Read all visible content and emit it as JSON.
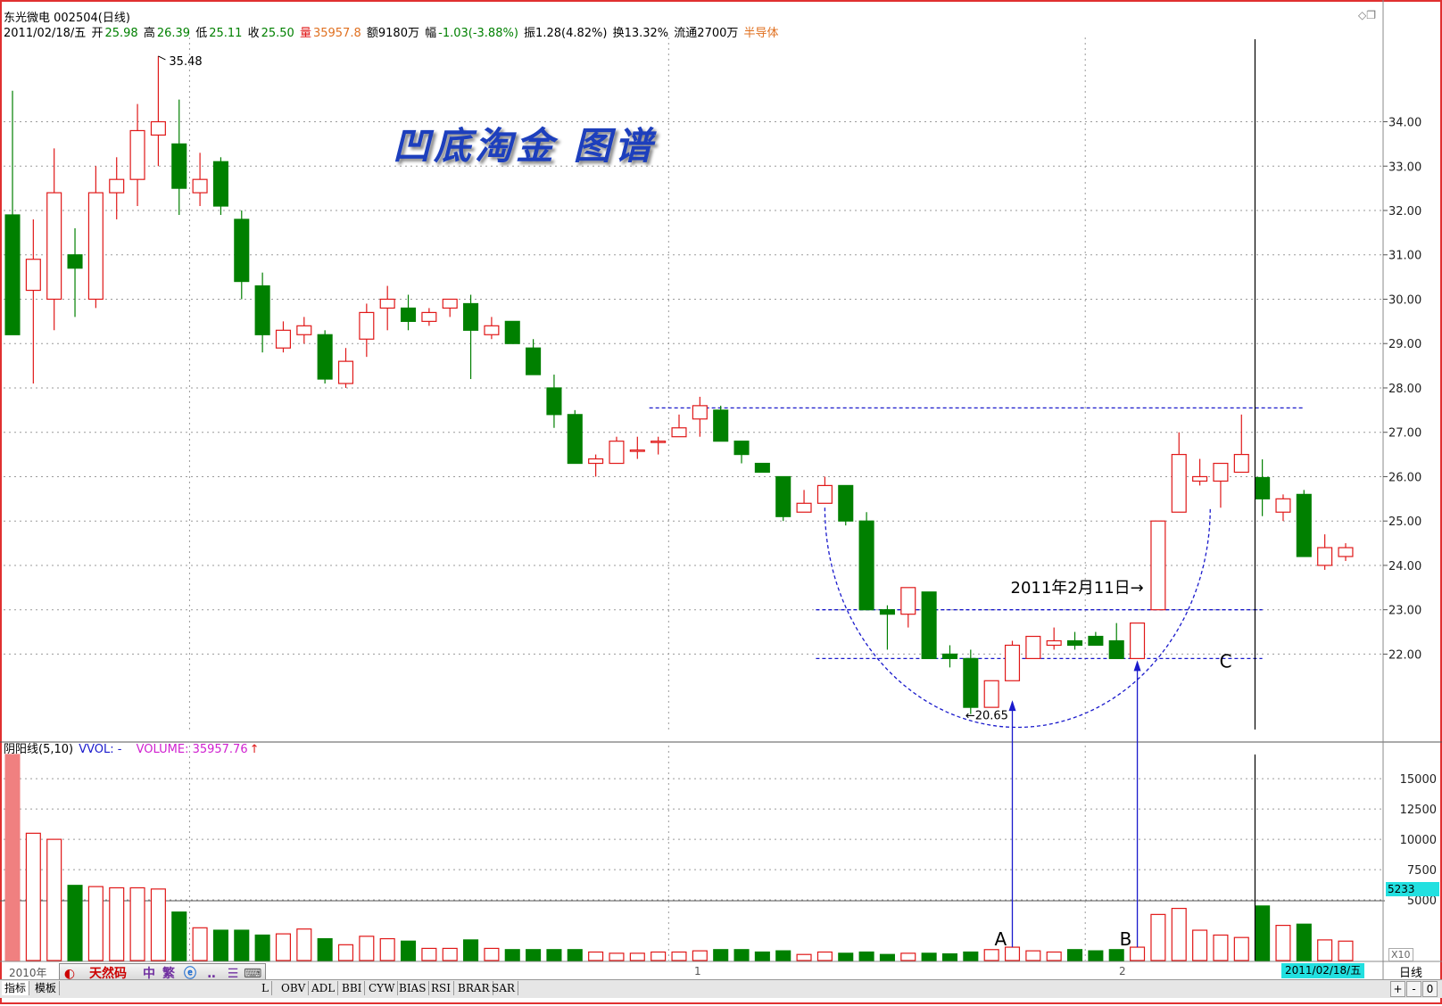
{
  "header": {
    "stock_name": "东光微电 002504(日线)",
    "date": "2011/02/18/五",
    "open_label": "开",
    "open": "25.98",
    "high_label": "高",
    "high": "26.39",
    "low_label": "低",
    "low": "25.11",
    "close_label": "收",
    "close": "25.50",
    "vol_label": "量",
    "vol": "35957.8",
    "amount": "额9180万",
    "range_label": "幅",
    "range": "-1.03(-3.88%)",
    "swing": "振1.28(4.82%)",
    "turnover": "换13.32%",
    "float_shares": "流通2700万",
    "sector": "半导体"
  },
  "watermark": "凹底淘金 图谱",
  "annotations": {
    "max_label": "35.48",
    "min_label": "←20.65",
    "date_note": "2011年2月11日→",
    "point_a": "A",
    "point_b": "B",
    "point_c": "C"
  },
  "volume_header": {
    "title": "阴阳线(5,10)",
    "vol_label": "VVOL: -",
    "volume_label": "VOLUME: 35957.76"
  },
  "volume_badge": "5233",
  "xaxis": {
    "year_label": "2010年",
    "month1": "1",
    "month2": "2",
    "cursor_date": "2011/02/18/五",
    "period": "日线"
  },
  "price_scale_label": "X10",
  "toolbar": {
    "ime_label": "天然码",
    "zh_label": "中",
    "trad_label": "繁"
  },
  "tabs": [
    "指标",
    "模板",
    "L",
    "OBV",
    "ADL",
    "BBI",
    "CYW",
    "BIAS",
    "RSI",
    "BRAR",
    "SAR"
  ],
  "bottom_buttons": [
    "+",
    "-",
    "0"
  ],
  "colors": {
    "up": "#e01818",
    "down": "#008000",
    "grid": "#9a9a9a",
    "annotation_line": "#1a1acc",
    "watermark": "#1d3fbd",
    "badge_bg": "#22e0e0"
  },
  "chart_data": {
    "type": "candlestick",
    "price_axis_ticks": [
      22.0,
      23.0,
      24.0,
      25.0,
      26.0,
      27.0,
      28.0,
      29.0,
      30.0,
      31.0,
      32.0,
      33.0,
      34.0
    ],
    "price_axis_tick_labels": [
      "22.00",
      "23.00",
      "24.00",
      "25.00",
      "26.00",
      "27.00",
      "28.00",
      "29.00",
      "30.00",
      "31.00",
      "32.00",
      "33.00",
      "34.00"
    ],
    "ylim": [
      20.3,
      35.9
    ],
    "volume_axis_ticks": [
      5000,
      7500,
      10000,
      12500,
      15000
    ],
    "volume_axis_tick_labels": [
      "5000",
      "7500",
      "10000",
      "12500",
      "15000"
    ],
    "volume_ylim": [
      0,
      17000
    ],
    "candles": [
      {
        "o": 31.9,
        "h": 34.7,
        "l": 29.2,
        "c": 29.2,
        "v": 17000
      },
      {
        "o": 30.2,
        "h": 31.8,
        "l": 28.1,
        "c": 30.9,
        "v": 10500
      },
      {
        "o": 30.0,
        "h": 33.4,
        "l": 29.3,
        "c": 32.4,
        "v": 10000
      },
      {
        "o": 31.0,
        "h": 31.6,
        "l": 29.6,
        "c": 30.7,
        "v": 6200
      },
      {
        "o": 30.0,
        "h": 33.0,
        "l": 29.8,
        "c": 32.4,
        "v": 6100
      },
      {
        "o": 32.4,
        "h": 33.2,
        "l": 31.8,
        "c": 32.7,
        "v": 6000
      },
      {
        "o": 32.7,
        "h": 34.4,
        "l": 32.1,
        "c": 33.8,
        "v": 6000
      },
      {
        "o": 33.7,
        "h": 35.48,
        "l": 33.0,
        "c": 34.0,
        "v": 5900
      },
      {
        "o": 33.5,
        "h": 34.5,
        "l": 31.9,
        "c": 32.5,
        "v": 4000
      },
      {
        "o": 32.4,
        "h": 33.3,
        "l": 32.1,
        "c": 32.7,
        "v": 2700
      },
      {
        "o": 33.1,
        "h": 33.2,
        "l": 31.9,
        "c": 32.1,
        "v": 2500
      },
      {
        "o": 31.8,
        "h": 32.0,
        "l": 30.0,
        "c": 30.4,
        "v": 2500
      },
      {
        "o": 30.3,
        "h": 30.6,
        "l": 28.8,
        "c": 29.2,
        "v": 2100
      },
      {
        "o": 28.9,
        "h": 29.5,
        "l": 28.8,
        "c": 29.3,
        "v": 2200
      },
      {
        "o": 29.2,
        "h": 29.6,
        "l": 29.0,
        "c": 29.4,
        "v": 2600
      },
      {
        "o": 29.2,
        "h": 29.3,
        "l": 28.1,
        "c": 28.2,
        "v": 1800
      },
      {
        "o": 28.1,
        "h": 28.9,
        "l": 28.0,
        "c": 28.6,
        "v": 1300
      },
      {
        "o": 29.1,
        "h": 29.9,
        "l": 28.7,
        "c": 29.7,
        "v": 2000
      },
      {
        "o": 29.8,
        "h": 30.3,
        "l": 29.3,
        "c": 30.0,
        "v": 1800
      },
      {
        "o": 29.8,
        "h": 30.1,
        "l": 29.3,
        "c": 29.5,
        "v": 1600
      },
      {
        "o": 29.5,
        "h": 29.8,
        "l": 29.4,
        "c": 29.7,
        "v": 1000
      },
      {
        "o": 29.8,
        "h": 30.0,
        "l": 29.6,
        "c": 30.0,
        "v": 1000
      },
      {
        "o": 29.9,
        "h": 30.1,
        "l": 28.2,
        "c": 29.3,
        "v": 1700
      },
      {
        "o": 29.2,
        "h": 29.6,
        "l": 29.1,
        "c": 29.4,
        "v": 1000
      },
      {
        "o": 29.5,
        "h": 29.5,
        "l": 29.0,
        "c": 29.0,
        "v": 900
      },
      {
        "o": 28.9,
        "h": 29.1,
        "l": 28.3,
        "c": 28.3,
        "v": 900
      },
      {
        "o": 28.0,
        "h": 28.3,
        "l": 27.1,
        "c": 27.4,
        "v": 900
      },
      {
        "o": 27.4,
        "h": 27.5,
        "l": 26.4,
        "c": 26.3,
        "v": 900
      },
      {
        "o": 26.3,
        "h": 26.5,
        "l": 26.0,
        "c": 26.4,
        "v": 700
      },
      {
        "o": 26.3,
        "h": 26.9,
        "l": 26.3,
        "c": 26.8,
        "v": 600
      },
      {
        "o": 26.6,
        "h": 26.9,
        "l": 26.4,
        "c": 26.6,
        "v": 600
      },
      {
        "o": 26.8,
        "h": 26.9,
        "l": 26.5,
        "c": 26.8,
        "v": 700
      },
      {
        "o": 26.9,
        "h": 27.4,
        "l": 26.9,
        "c": 27.1,
        "v": 700
      },
      {
        "o": 27.3,
        "h": 27.8,
        "l": 26.9,
        "c": 27.6,
        "v": 800
      },
      {
        "o": 27.5,
        "h": 27.6,
        "l": 26.8,
        "c": 26.8,
        "v": 900
      },
      {
        "o": 26.8,
        "h": 26.8,
        "l": 26.3,
        "c": 26.5,
        "v": 900
      },
      {
        "o": 26.3,
        "h": 26.3,
        "l": 26.2,
        "c": 26.1,
        "v": 700
      },
      {
        "o": 26.0,
        "h": 26.0,
        "l": 25.0,
        "c": 25.1,
        "v": 800
      },
      {
        "o": 25.2,
        "h": 25.7,
        "l": 25.2,
        "c": 25.4,
        "v": 500
      },
      {
        "o": 25.4,
        "h": 26.0,
        "l": 25.4,
        "c": 25.8,
        "v": 700
      },
      {
        "o": 25.8,
        "h": 25.8,
        "l": 24.9,
        "c": 25.0,
        "v": 600
      },
      {
        "o": 25.0,
        "h": 25.2,
        "l": 23.0,
        "c": 23.0,
        "v": 700
      },
      {
        "o": 23.0,
        "h": 23.1,
        "l": 22.1,
        "c": 22.9,
        "v": 500
      },
      {
        "o": 22.9,
        "h": 23.5,
        "l": 22.6,
        "c": 23.5,
        "v": 600
      },
      {
        "o": 23.4,
        "h": 23.4,
        "l": 21.9,
        "c": 21.9,
        "v": 600
      },
      {
        "o": 22.0,
        "h": 22.2,
        "l": 21.7,
        "c": 21.9,
        "v": 550
      },
      {
        "o": 21.9,
        "h": 22.1,
        "l": 20.65,
        "c": 20.8,
        "v": 700
      },
      {
        "o": 20.8,
        "h": 21.4,
        "l": 20.8,
        "c": 21.4,
        "v": 900
      },
      {
        "o": 21.4,
        "h": 22.3,
        "l": 21.4,
        "c": 22.2,
        "v": 1100
      },
      {
        "o": 21.9,
        "h": 22.4,
        "l": 21.9,
        "c": 22.4,
        "v": 800
      },
      {
        "o": 22.2,
        "h": 22.6,
        "l": 22.1,
        "c": 22.3,
        "v": 700
      },
      {
        "o": 22.3,
        "h": 22.5,
        "l": 22.1,
        "c": 22.2,
        "v": 900
      },
      {
        "o": 22.4,
        "h": 22.5,
        "l": 22.2,
        "c": 22.2,
        "v": 800
      },
      {
        "o": 22.3,
        "h": 22.7,
        "l": 21.9,
        "c": 21.9,
        "v": 900
      },
      {
        "o": 21.9,
        "h": 22.7,
        "l": 21.9,
        "c": 22.7,
        "v": 1100
      },
      {
        "o": 23.0,
        "h": 25.0,
        "l": 23.0,
        "c": 25.0,
        "v": 3800
      },
      {
        "o": 25.2,
        "h": 27.0,
        "l": 25.2,
        "c": 26.5,
        "v": 4300
      },
      {
        "o": 25.9,
        "h": 26.4,
        "l": 25.8,
        "c": 26.0,
        "v": 2500
      },
      {
        "o": 25.9,
        "h": 26.3,
        "l": 25.3,
        "c": 26.3,
        "v": 2100
      },
      {
        "o": 26.1,
        "h": 27.4,
        "l": 26.1,
        "c": 26.5,
        "v": 1900
      },
      {
        "o": 25.98,
        "h": 26.39,
        "l": 25.11,
        "c": 25.5,
        "v": 4500
      },
      {
        "o": 25.2,
        "h": 25.6,
        "l": 25.0,
        "c": 25.5,
        "v": 2900
      },
      {
        "o": 25.6,
        "h": 25.7,
        "l": 24.2,
        "c": 24.2,
        "v": 3000
      },
      {
        "o": 24.0,
        "h": 24.7,
        "l": 23.9,
        "c": 24.4,
        "v": 1700
      },
      {
        "o": 24.2,
        "h": 24.5,
        "l": 24.1,
        "c": 24.4,
        "v": 1600
      }
    ],
    "reference_lines": [
      27.55,
      23.0,
      21.9
    ],
    "cursor_index": 60
  }
}
